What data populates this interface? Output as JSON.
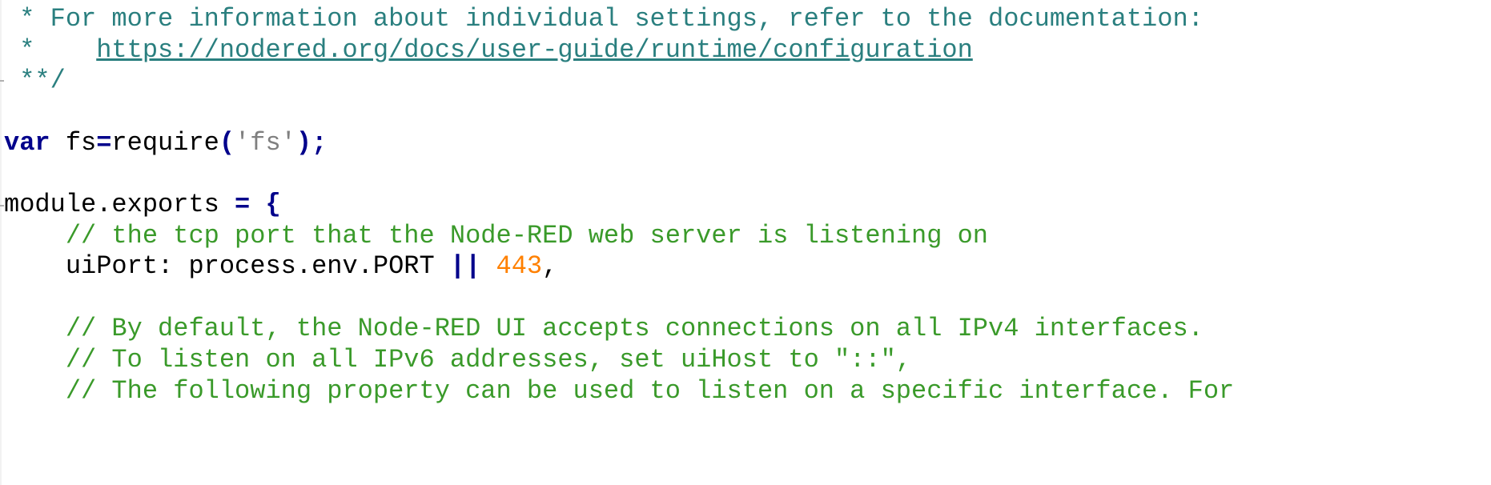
{
  "editor": {
    "lines": [
      {
        "doc_star": " * ",
        "doc_text": "For more information about individual settings, refer to the documentation:"
      },
      {
        "doc_star": " *    ",
        "link_text": "https://nodered.org/docs/user-guide/runtime/configuration"
      },
      {
        "doc_end": " **/"
      },
      {
        "keyword": "var",
        "ident": " fs",
        "assign": "=",
        "call": "require",
        "paren_open": "(",
        "string": "'fs'",
        "paren_close": ")",
        "semi": ";"
      },
      {
        "ident": "module.exports",
        "space": " ",
        "assign": "=",
        "space2": " ",
        "brace": "{"
      },
      {
        "indent": "    ",
        "comment": "// the tcp port that the Node-RED web server is listening on"
      },
      {
        "indent": "    ",
        "prop": "uiPort: process.env.PORT ",
        "op": "||",
        "space": " ",
        "number": "443",
        "comma": ","
      },
      {
        "indent": "    ",
        "comment": "// By default, the Node-RED UI accepts connections on all IPv4 interfaces."
      },
      {
        "indent": "    ",
        "comment": "// To listen on all IPv6 addresses, set uiHost to \"::\","
      },
      {
        "indent": "    ",
        "comment": "// The following property can be used to listen on a specific interface. For"
      }
    ]
  },
  "colors": {
    "doc_comment": "#2a7f7f",
    "line_comment": "#3a9a2a",
    "keyword": "#00008b",
    "string": "#808080",
    "number": "#ff8000"
  }
}
